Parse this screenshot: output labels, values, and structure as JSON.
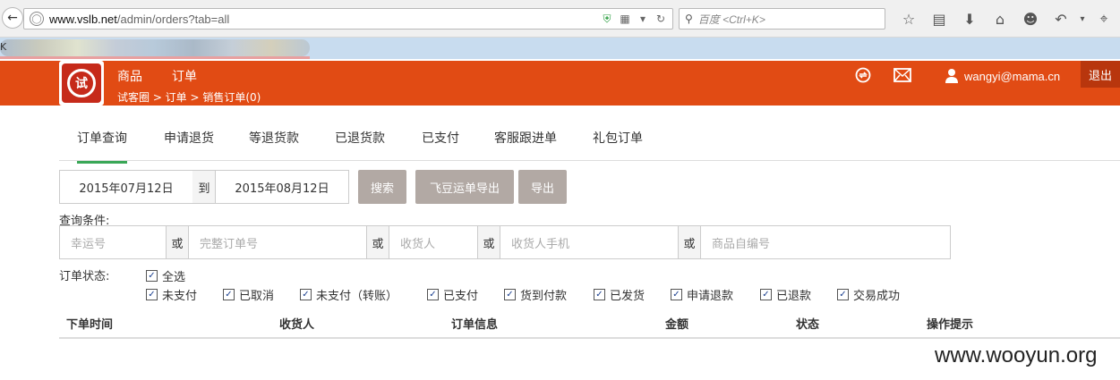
{
  "browser": {
    "url_domain": "www.vslb.net",
    "url_path": "/admin/orders?tab=all",
    "search_placeholder": "百度 <Ctrl+K>",
    "bookmark_marker": "K"
  },
  "header": {
    "logo_text": "试",
    "nav": [
      "商品",
      "订单"
    ],
    "breadcrumb": "试客圈 > 订单 > 销售订单(0)",
    "user": "wangyi@mama.cn",
    "logout": "退出"
  },
  "tabs": [
    "订单查询",
    "申请退货",
    "等退货款",
    "已退货款",
    "已支付",
    "客服跟进单",
    "礼包订单"
  ],
  "filters": {
    "date_from": "2015年07月12日",
    "to_label": "到",
    "date_to": "2015年08月12日",
    "search_btn": "搜索",
    "export_feidou_btn": "飞豆运单导出",
    "export_btn": "导出",
    "conditions_label": "查询条件:",
    "or_label": "或",
    "fields": [
      "幸运号",
      "完整订单号",
      "收货人",
      "收货人手机",
      "商品自编号"
    ]
  },
  "status": {
    "label": "订单状态:",
    "select_all": "全选",
    "options": [
      "未支付",
      "已取消",
      "未支付（转账）",
      "已支付",
      "货到付款",
      "已发货",
      "申请退款",
      "已退款",
      "交易成功"
    ]
  },
  "table": {
    "columns": [
      "下单时间",
      "收货人",
      "订单信息",
      "金额",
      "状态",
      "操作提示"
    ]
  },
  "watermark": "www.wooyun.org",
  "colors": {
    "header_bg": "#e14b14",
    "active_tab": "#3aa757",
    "gray_button": "#b2a9a4"
  }
}
